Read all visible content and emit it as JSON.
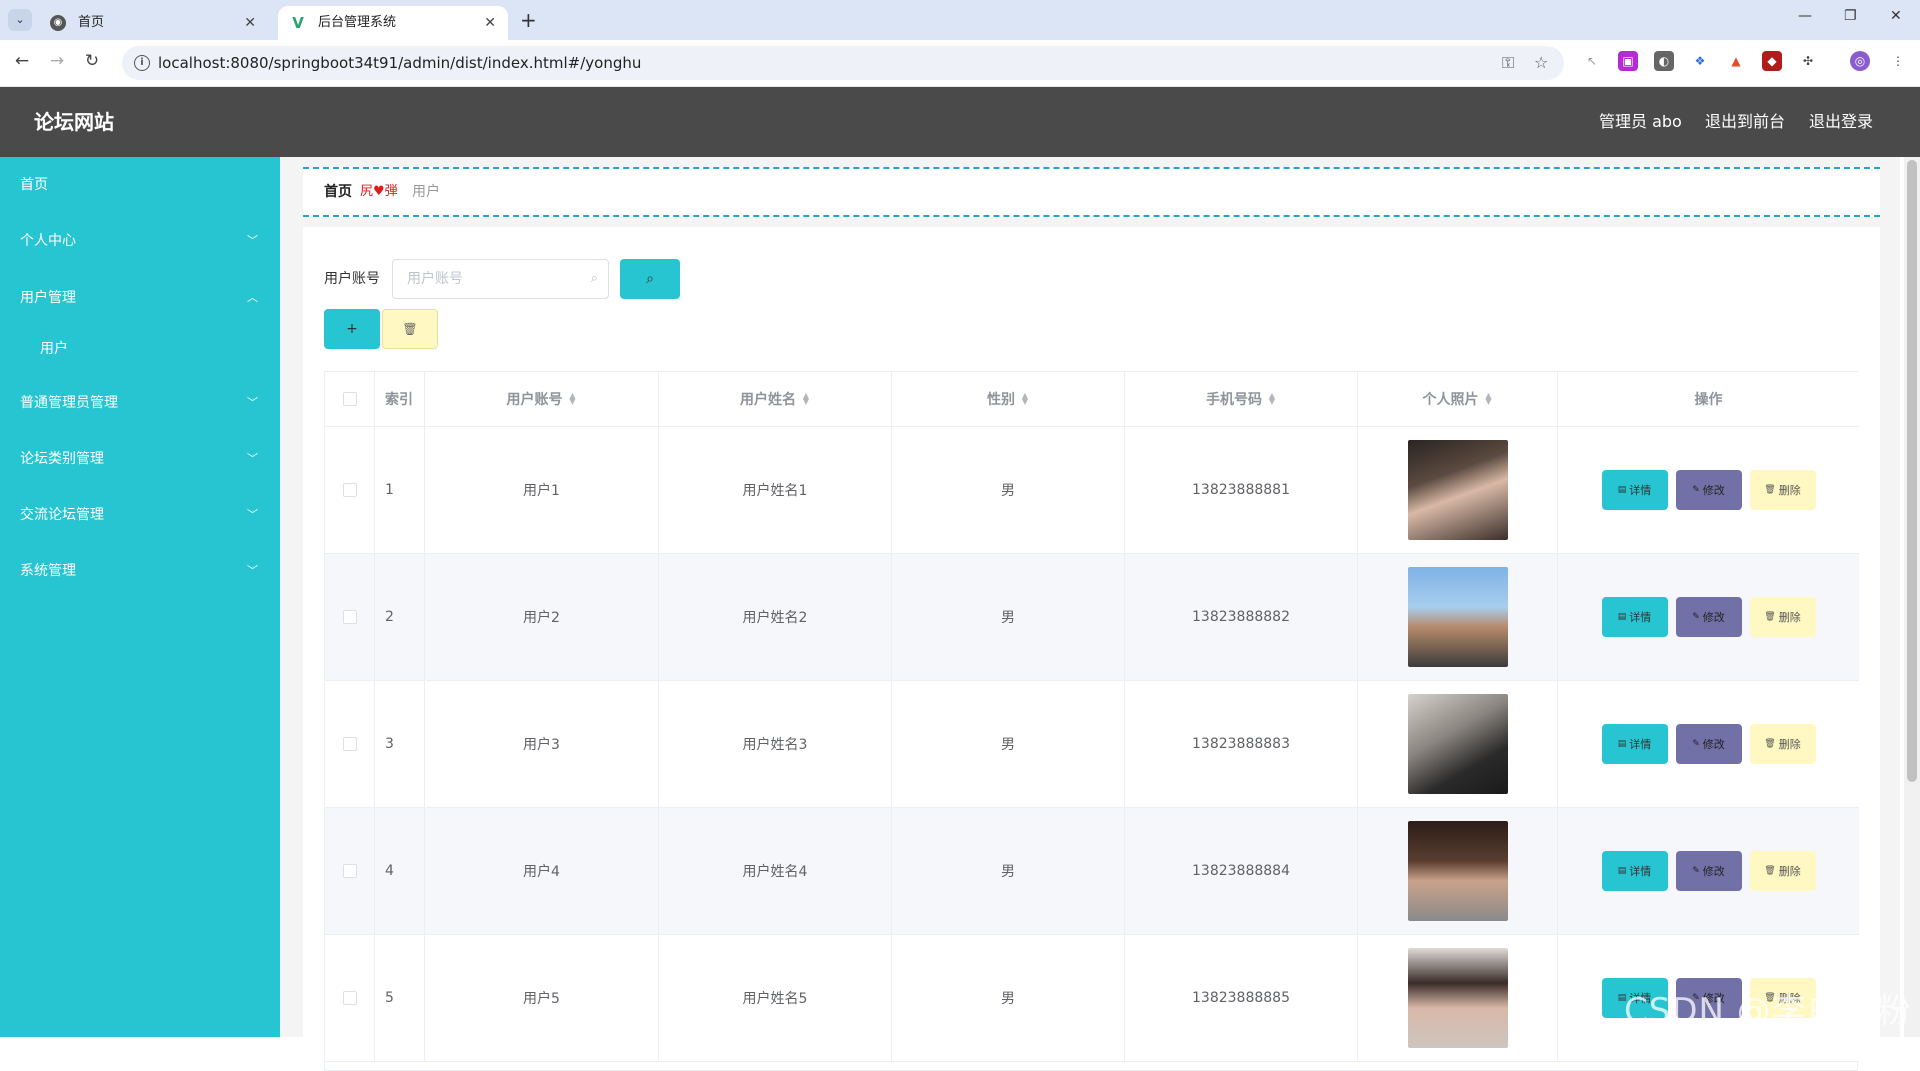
{
  "browser": {
    "tabs": [
      {
        "title": "首页",
        "active": false
      },
      {
        "title": "后台管理系统",
        "active": true
      }
    ],
    "url": "localhost:8080/springboot34t91/admin/dist/index.html#/yonghu"
  },
  "header": {
    "title": "论坛网站",
    "user_label": "管理员 abo",
    "front_link": "退出到前台",
    "logout_link": "退出登录"
  },
  "sidebar": {
    "items": [
      {
        "label": "首页",
        "expandable": false
      },
      {
        "label": "个人中心",
        "expandable": true,
        "expanded": false
      },
      {
        "label": "用户管理",
        "expandable": true,
        "expanded": true
      },
      {
        "label": "用户",
        "sub": true
      },
      {
        "label": "普通管理员管理",
        "expandable": true,
        "expanded": false
      },
      {
        "label": "论坛类别管理",
        "expandable": true,
        "expanded": false
      },
      {
        "label": "交流论坛管理",
        "expandable": true,
        "expanded": false
      },
      {
        "label": "系统管理",
        "expandable": true,
        "expanded": false
      }
    ]
  },
  "breadcrumb": {
    "home": "首页",
    "separator": "尻♥弾",
    "current": "用户"
  },
  "search": {
    "label": "用户账号",
    "placeholder": "用户账号",
    "value": ""
  },
  "table": {
    "columns": [
      "索引",
      "用户账号",
      "用户姓名",
      "性别",
      "手机号码",
      "个人照片",
      "操作"
    ],
    "rows": [
      {
        "index": "1",
        "account": "用户1",
        "name": "用户姓名1",
        "gender": "男",
        "phone": "13823888881"
      },
      {
        "index": "2",
        "account": "用户2",
        "name": "用户姓名2",
        "gender": "男",
        "phone": "13823888882"
      },
      {
        "index": "3",
        "account": "用户3",
        "name": "用户姓名3",
        "gender": "男",
        "phone": "13823888883"
      },
      {
        "index": "4",
        "account": "用户4",
        "name": "用户姓名4",
        "gender": "男",
        "phone": "13823888884"
      },
      {
        "index": "5",
        "account": "用户5",
        "name": "用户姓名5",
        "gender": "男",
        "phone": "13823888885"
      }
    ],
    "actions": {
      "detail": "详情",
      "edit": "修改",
      "delete": "删除"
    }
  },
  "watermark": "CSDN @李白的粉",
  "colors": {
    "accent": "#26c5d1",
    "header": "#4a4a4a",
    "edit_button": "#7171a8",
    "delete_button": "#fff8c2",
    "breadcrumb_border": "#26a3c5"
  }
}
